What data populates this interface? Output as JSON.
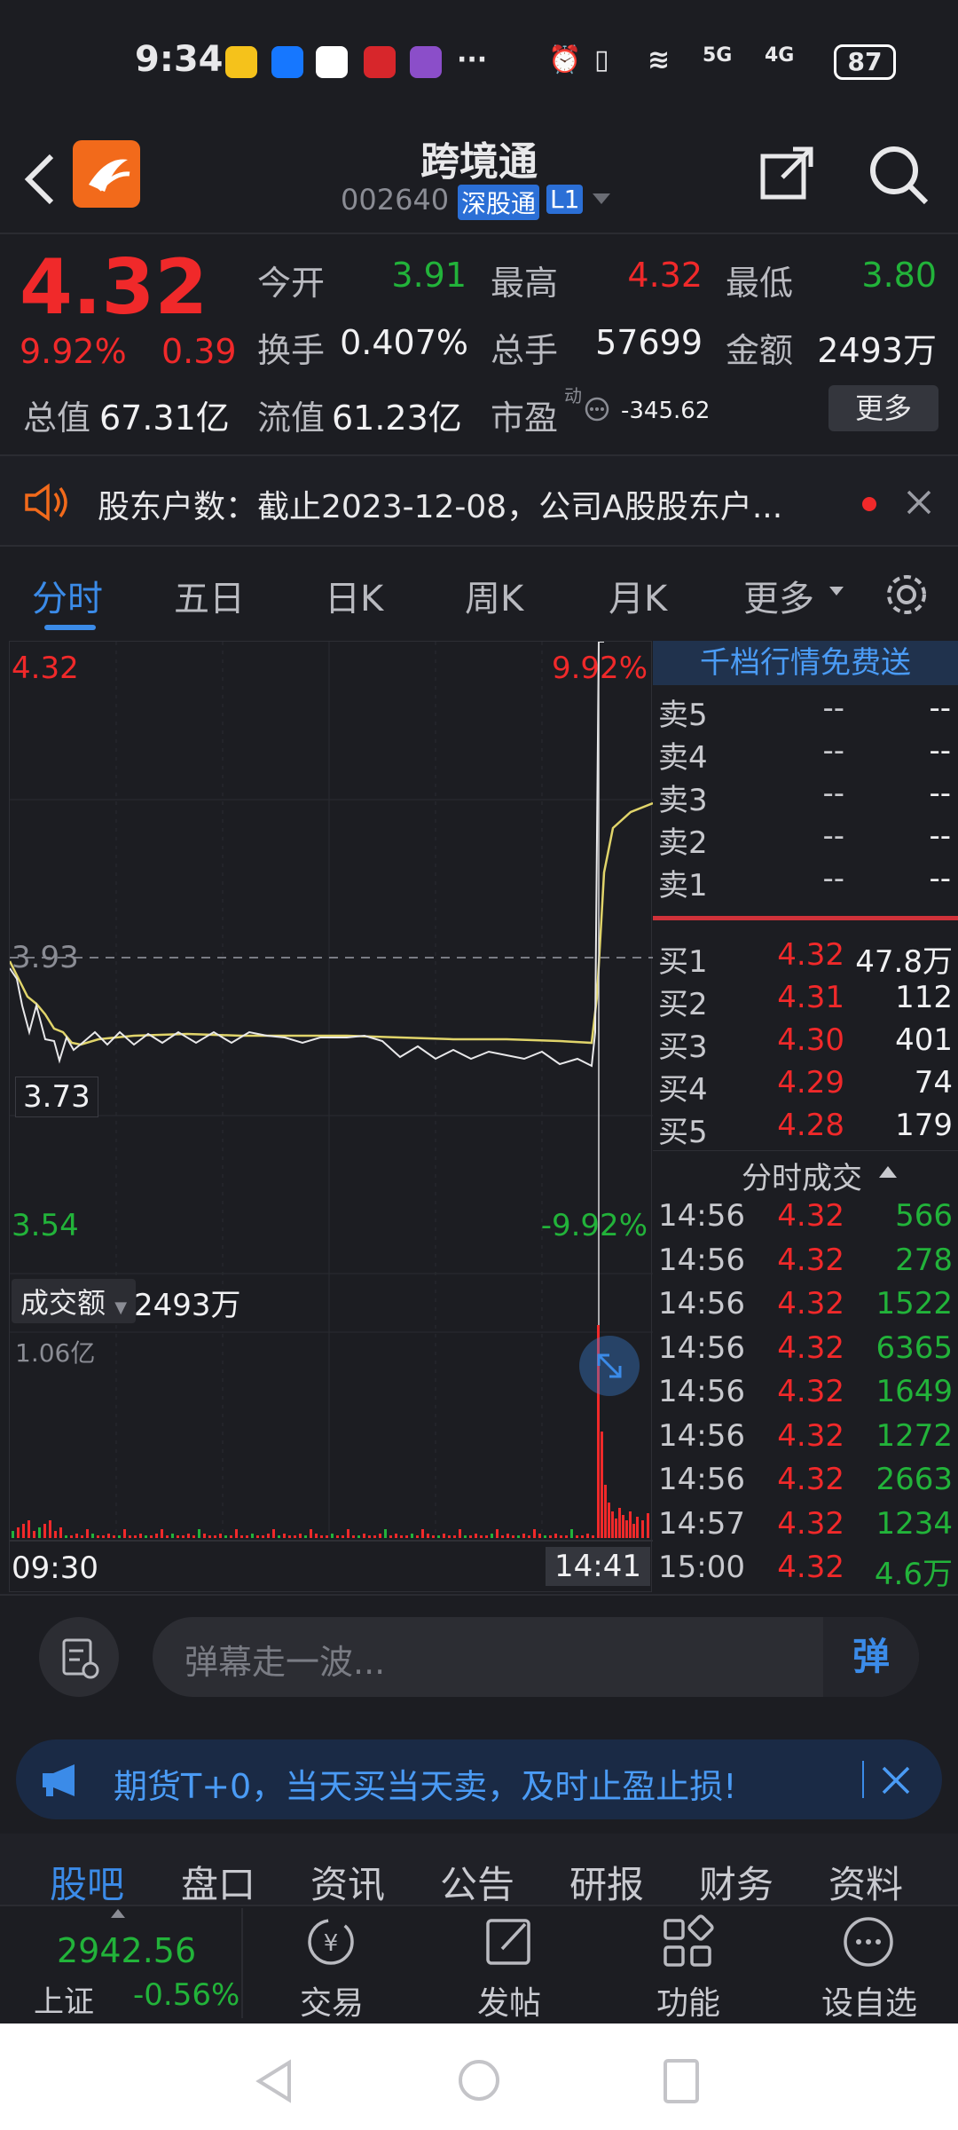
{
  "status": {
    "time": "9:34",
    "more": "···",
    "signal5g": "5G",
    "signal4g": "4G",
    "battery": "87"
  },
  "header": {
    "title": "跨境通",
    "code": "002640",
    "badge": "深股通",
    "level": "L1"
  },
  "quote": {
    "price": "4.32",
    "pct": "9.92%",
    "chg": "0.39",
    "open_label": "今开",
    "open": "3.91",
    "high_label": "最高",
    "high": "4.32",
    "low_label": "最低",
    "low": "3.80",
    "turnover_label": "换手",
    "turnover": "0.407%",
    "volume_label": "总手",
    "volume": "57699",
    "amount_label": "金额",
    "amount": "2493万",
    "mktcap_label": "总值",
    "mktcap": "67.31亿",
    "float_label": "流值",
    "float": "61.23亿",
    "pe_label": "市盈",
    "pe_sup": "动",
    "pe": "-345.62",
    "more_btn": "更多"
  },
  "notice": {
    "text": "股东户数：截止2023-12-08，公司A股股东户..."
  },
  "tabs": [
    "分时",
    "五日",
    "日K",
    "周K",
    "月K",
    "更多"
  ],
  "chart": {
    "top_price": "4.32",
    "top_pct": "9.92%",
    "mid_price": "3.93",
    "cursor_price": "3.73",
    "bottom_price": "3.54",
    "bottom_pct": "-9.92%",
    "vol_selector": "成交额",
    "vol_value": "2493万",
    "vol_max": "1.06亿",
    "start_time": "09:30",
    "cursor_time": "14:41"
  },
  "order_book": {
    "promo": "千档行情免费送",
    "asks": [
      {
        "label": "卖5",
        "price": "--",
        "vol": "--"
      },
      {
        "label": "卖4",
        "price": "--",
        "vol": "--"
      },
      {
        "label": "卖3",
        "price": "--",
        "vol": "--"
      },
      {
        "label": "卖2",
        "price": "--",
        "vol": "--"
      },
      {
        "label": "卖1",
        "price": "--",
        "vol": "--"
      }
    ],
    "bids": [
      {
        "label": "买1",
        "price": "4.32",
        "vol": "47.8万"
      },
      {
        "label": "买2",
        "price": "4.31",
        "vol": "112"
      },
      {
        "label": "买3",
        "price": "4.30",
        "vol": "401"
      },
      {
        "label": "买4",
        "price": "4.29",
        "vol": "74"
      },
      {
        "label": "买5",
        "price": "4.28",
        "vol": "179"
      }
    ],
    "trades_title": "分时成交",
    "trades": [
      {
        "time": "14:56",
        "price": "4.32",
        "vol": "566"
      },
      {
        "time": "14:56",
        "price": "4.32",
        "vol": "278"
      },
      {
        "time": "14:56",
        "price": "4.32",
        "vol": "1522"
      },
      {
        "time": "14:56",
        "price": "4.32",
        "vol": "6365"
      },
      {
        "time": "14:56",
        "price": "4.32",
        "vol": "1649"
      },
      {
        "time": "14:56",
        "price": "4.32",
        "vol": "1272"
      },
      {
        "time": "14:56",
        "price": "4.32",
        "vol": "2663"
      },
      {
        "time": "14:57",
        "price": "4.32",
        "vol": "1234"
      },
      {
        "time": "15:00",
        "price": "4.32",
        "vol": "4.6万"
      }
    ]
  },
  "danmaku": {
    "placeholder": "弹幕走一波...",
    "send": "弹"
  },
  "ad": {
    "text": "期货T+0，当天买当天卖，及时止盈止损!"
  },
  "bottom_tabs": [
    "股吧",
    "盘口",
    "资讯",
    "公告",
    "研报",
    "财务",
    "资料"
  ],
  "footer": {
    "index_value": "2942.56",
    "index_name": "上证",
    "index_pct": "-0.56%",
    "items": [
      "交易",
      "发帖",
      "功能",
      "设自选"
    ]
  },
  "colors": {
    "up": "#f0292a",
    "down": "#22b33a",
    "accent": "#3b8be8",
    "bg": "#1c1d22"
  }
}
